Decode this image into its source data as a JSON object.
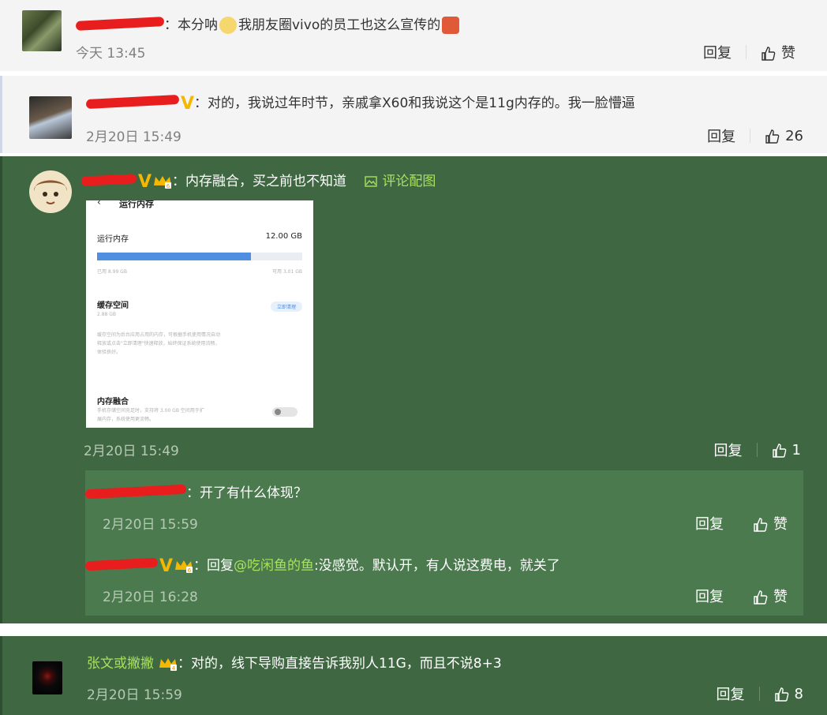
{
  "comments": [
    {
      "text": "：本分呐",
      "text2": "我朋友圈vivo的员工也这么宣传的",
      "time": "今天 13:45",
      "reply_label": "回复",
      "like_label": "赞"
    },
    {
      "text": "：对的，我说过年时节，亲戚拿X60和我说这个是11g内存的。我一脸懵逼",
      "time": "2月20日 15:49",
      "reply_label": "回复",
      "like_count": "26",
      "vbadge": "V"
    },
    {
      "text": "：内存融合，买之前也不知道",
      "attach_label": "评论配图",
      "time": "2月20日 15:49",
      "reply_label": "回复",
      "like_count": "1",
      "vbadge": "V",
      "image": {
        "header": "运行内存",
        "ram_label": "运行内存",
        "ram_value": "12.00 GB",
        "used": "已用 8.99 GB",
        "free": "可用 3.01 GB",
        "used_fraction": 0.749,
        "cache_title": "缓存空间",
        "cache_size": "2.88 GB",
        "clean_btn": "立即清理",
        "cache_desc1": "缓存空间为后台应用占用的内存，可根据手机使用情况自动",
        "cache_desc2": "释放或点击\"立即清理\"快速释放，始终保证系统使用流畅，",
        "cache_desc3": "体验良好。",
        "fusion_title": "内存融合",
        "fusion_desc1": "手机存储空间充足时，支持将 3.00 GB 空间用于扩",
        "fusion_desc2": "展内存，系统使用更流畅。"
      },
      "replies": [
        {
          "text": "：开了有什么体现？",
          "time": "2月20日 15:59",
          "reply_label": "回复",
          "like_label": "赞"
        },
        {
          "text_prefix": "：回复",
          "mention": "@吃闲鱼的鱼",
          "text_suffix": ":没感觉。默认开，有人说这费电，就关了",
          "time": "2月20日 16:28",
          "reply_label": "回复",
          "like_label": "赞",
          "vbadge": "V"
        }
      ]
    },
    {
      "username": "张文或撇撇",
      "text": "：对的，线下导购直接告诉我别人11G，而且不说8+3",
      "time": "2月20日 15:59",
      "reply_label": "回复",
      "like_count": "8"
    }
  ]
}
